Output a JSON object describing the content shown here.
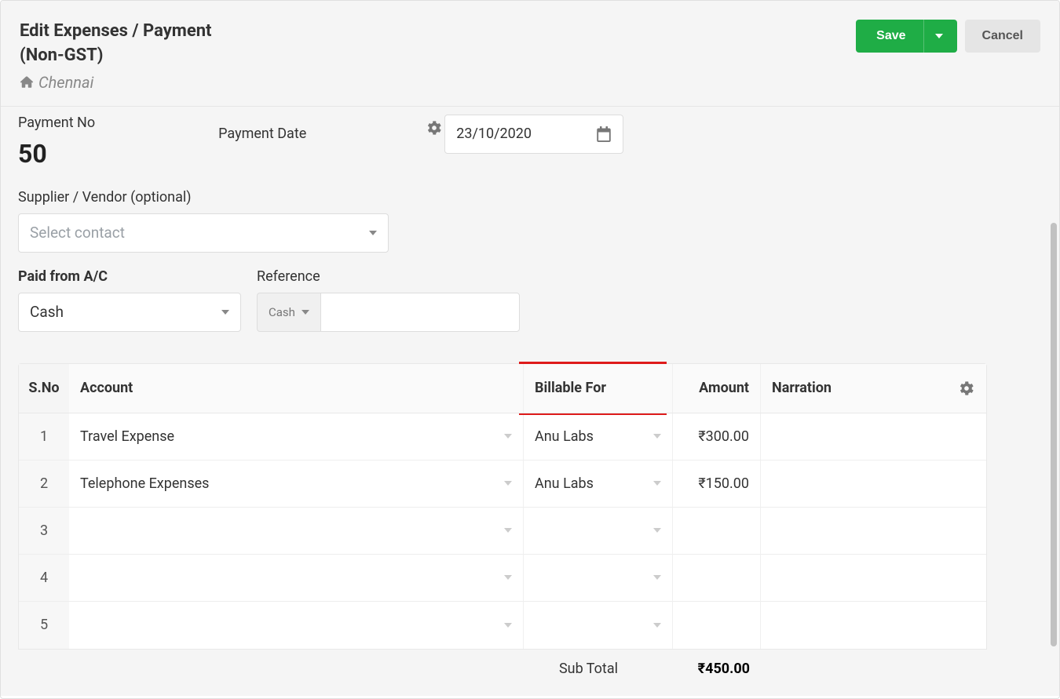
{
  "page_title_line1": "Edit Expenses / Payment",
  "page_title_line2": "(Non-GST)",
  "location": "Chennai",
  "buttons": {
    "save": "Save",
    "cancel": "Cancel"
  },
  "fields": {
    "paymentNo": {
      "label": "Payment No",
      "value": "50"
    },
    "paymentDate": {
      "label": "Payment Date",
      "value": "23/10/2020"
    },
    "supplier": {
      "label": "Supplier / Vendor (optional)",
      "placeholder": "Select contact"
    },
    "paidFrom": {
      "label": "Paid from A/C",
      "value": "Cash"
    },
    "reference": {
      "label": "Reference",
      "type": "Cash",
      "value": ""
    }
  },
  "table": {
    "headers": {
      "sno": "S.No",
      "account": "Account",
      "billable": "Billable For",
      "amount": "Amount",
      "narration": "Narration"
    },
    "rows": [
      {
        "sno": "1",
        "account": "Travel Expense",
        "billable": "Anu Labs",
        "amount": "₹300.00",
        "narration": ""
      },
      {
        "sno": "2",
        "account": "Telephone Expenses",
        "billable": "Anu Labs",
        "amount": "₹150.00",
        "narration": ""
      },
      {
        "sno": "3",
        "account": "",
        "billable": "",
        "amount": "",
        "narration": ""
      },
      {
        "sno": "4",
        "account": "",
        "billable": "",
        "amount": "",
        "narration": ""
      },
      {
        "sno": "5",
        "account": "",
        "billable": "",
        "amount": "",
        "narration": ""
      }
    ],
    "subtotal": {
      "label": "Sub Total",
      "value": "₹450.00"
    }
  }
}
